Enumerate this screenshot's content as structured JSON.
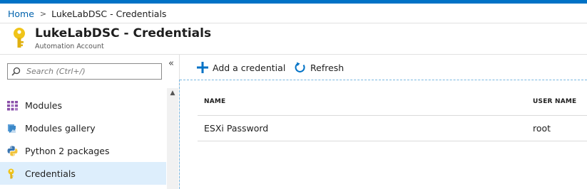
{
  "breadcrumb": {
    "home": "Home",
    "separator": ">",
    "current": "LukeLabDSC - Credentials"
  },
  "header": {
    "icon": "key-icon",
    "title": "LukeLabDSC - Credentials",
    "subtitle": "Automation Account"
  },
  "sidebar": {
    "search_placeholder": "Search (Ctrl+/)",
    "collapse_label": "«",
    "items": [
      {
        "label": "Modules",
        "icon": "modules-grid-icon",
        "active": false
      },
      {
        "label": "Modules gallery",
        "icon": "gallery-icon",
        "active": false
      },
      {
        "label": "Python 2 packages",
        "icon": "python-icon",
        "active": false
      },
      {
        "label": "Credentials",
        "icon": "key-icon",
        "active": true
      }
    ]
  },
  "toolbar": {
    "add_label": "Add a credential",
    "refresh_label": "Refresh"
  },
  "grid": {
    "columns": [
      "NAME",
      "USER NAME"
    ],
    "rows": [
      {
        "name": "ESXi Password",
        "user_name": "root"
      }
    ]
  },
  "colors": {
    "accent": "#0072c6",
    "link": "#0062ad",
    "active_item": "#ddeefc",
    "key_gold": "#f0c419"
  }
}
